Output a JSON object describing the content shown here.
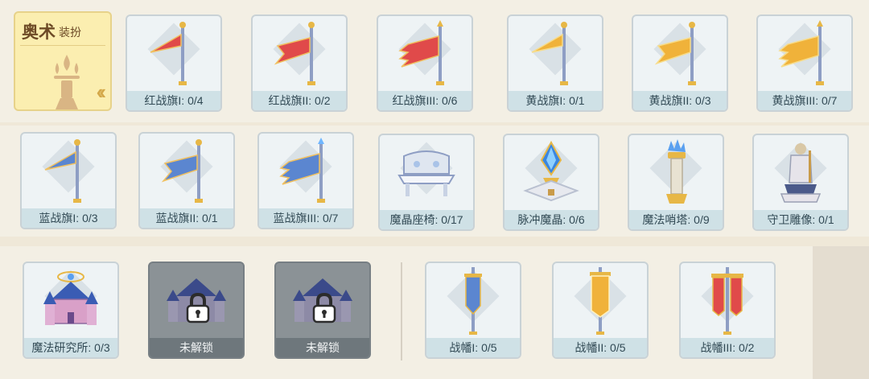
{
  "header": {
    "title": "奥术",
    "subtitle": "装扮",
    "collapse_icon": "double-chevron-left-icon"
  },
  "colors": {
    "red": "#e04a4a",
    "yellow": "#f0b23a",
    "blue": "#5b86d0",
    "pole": "#8e9ec4",
    "gold": "#e7b746"
  },
  "rows": [
    [
      {
        "name": "red-flag-1",
        "label": "红战旗I: 0/4",
        "icon": "red-flag-icon"
      },
      {
        "name": "red-flag-2",
        "label": "红战旗II: 0/2",
        "icon": "red-flag-icon"
      },
      {
        "name": "red-flag-3",
        "label": "红战旗III: 0/6",
        "icon": "red-flag-icon"
      },
      {
        "name": "yellow-flag-1",
        "label": "黄战旗I: 0/1",
        "icon": "yellow-flag-icon"
      },
      {
        "name": "yellow-flag-2",
        "label": "黄战旗II: 0/3",
        "icon": "yellow-flag-icon"
      },
      {
        "name": "yellow-flag-3",
        "label": "黄战旗III: 0/7",
        "icon": "yellow-flag-icon"
      }
    ],
    [
      {
        "name": "blue-flag-1",
        "label": "蓝战旗I: 0/3",
        "icon": "blue-flag-icon"
      },
      {
        "name": "blue-flag-2",
        "label": "蓝战旗II: 0/1",
        "icon": "blue-flag-icon"
      },
      {
        "name": "blue-flag-3",
        "label": "蓝战旗III: 0/7",
        "icon": "blue-flag-icon"
      },
      {
        "name": "crystal-bench",
        "label": "魔晶座椅: 0/17",
        "icon": "bench-icon"
      },
      {
        "name": "pulse-crystal",
        "label": "脉冲魔晶: 0/6",
        "icon": "crystal-icon"
      },
      {
        "name": "magic-tower",
        "label": "魔法哨塔: 0/9",
        "icon": "tower-icon"
      },
      {
        "name": "guardian-statue",
        "label": "守卫雕像: 0/1",
        "icon": "statue-icon"
      }
    ],
    [
      {
        "name": "magic-institute",
        "label": "魔法研究所: 0/3",
        "icon": "institute-icon"
      },
      {
        "name": "locked-item-1",
        "label": "未解锁",
        "icon": "lock-icon"
      },
      {
        "name": "locked-item-2",
        "label": "未解锁",
        "icon": "lock-icon"
      },
      {
        "name": "banner-1",
        "label": "战幡I: 0/5",
        "icon": "banner-icon"
      },
      {
        "name": "banner-2",
        "label": "战幡II: 0/5",
        "icon": "banner-icon"
      },
      {
        "name": "banner-3",
        "label": "战幡III: 0/2",
        "icon": "banner-icon"
      }
    ]
  ]
}
